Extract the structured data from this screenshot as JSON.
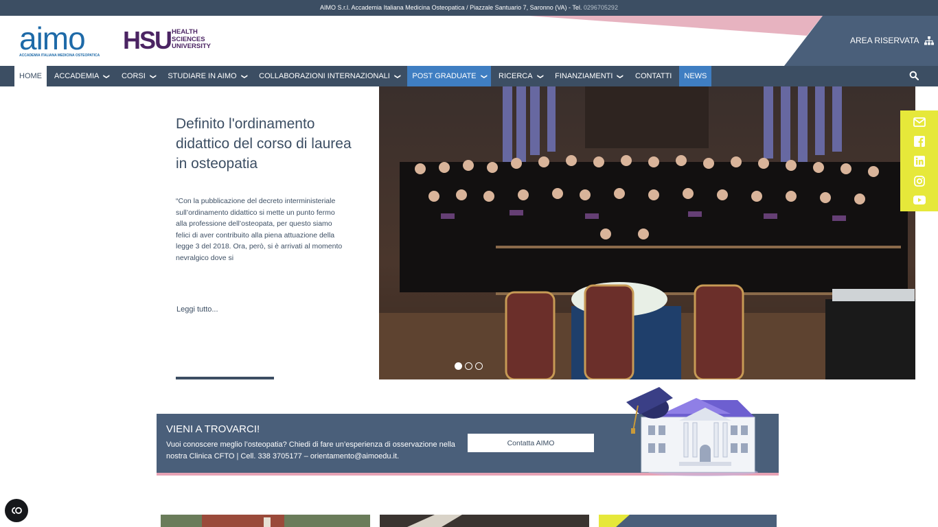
{
  "topbar": {
    "text": "AIMO S.r.l. Accademia Italiana Medicina Osteopatica / Piazzale Santuario 7, Saronno (VA) - Tel. ",
    "phone": "0296705292"
  },
  "header": {
    "aimo_logo": "aimo",
    "aimo_sub": "ACCADEMIA ITALIANA MEDICINA OSTEOPATICA",
    "hsu_logo": "HSU",
    "hsu_line1": "HEALTH",
    "hsu_line2": "SCIENCES",
    "hsu_line3": "UNIVERSITY",
    "area_riservata": "AREA RISERVATA"
  },
  "nav": {
    "items": [
      {
        "label": "HOME"
      },
      {
        "label": "ACCADEMIA"
      },
      {
        "label": "CORSI"
      },
      {
        "label": "STUDIARE IN AIMO"
      },
      {
        "label": "COLLABORAZIONI INTERNAZIONALI"
      },
      {
        "label": "POST GRADUATE"
      },
      {
        "label": "RICERCA"
      },
      {
        "label": "FINANZIAMENTI"
      },
      {
        "label": "CONTATTI"
      },
      {
        "label": "NEWS"
      }
    ]
  },
  "hero": {
    "title": "Definito l'ordinamento didattico del corso di laurea in osteopatia",
    "body": "“Con la pubblicazione del decreto interministeriale sull’ordinamento didattico si mette un punto fermo alla professione dell’osteopata, per questo siamo felici di aver contribuito alla piena attuazione della legge 3 del 2018. Ora, però, si è arrivati al momento nevralgico dove si",
    "read_more": "Leggi tutto...",
    "slider_active": 1,
    "slider_count": 3
  },
  "banner": {
    "title": "VIENI A TROVARCI!",
    "text": "Vuoi conoscere meglio l’osteopatia? Chiedi di fare un’esperienza di osservazione nella nostra Clinica CFTO  |  Cell. 338 3705177  – orientamento@aimoedu.it.",
    "button": "Contatta AIMO"
  },
  "colors": {
    "navy": "#3c4e63",
    "accent_blue": "#3f7ec2",
    "yellow": "#e6e83a",
    "pink": "#e7a2b4",
    "banner": "#4a5f7a"
  },
  "social_icons": [
    "mail-icon",
    "facebook-icon",
    "linkedin-icon",
    "instagram-icon",
    "youtube-icon"
  ]
}
